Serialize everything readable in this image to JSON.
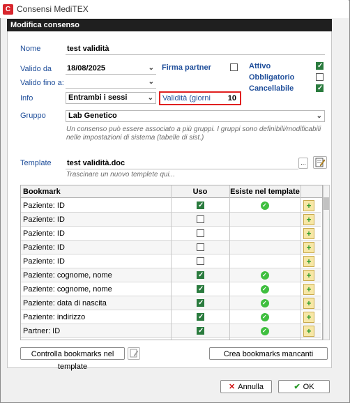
{
  "window": {
    "title": "Consensi MediTEX",
    "icon": "meditex-app-icon"
  },
  "dialog": {
    "title": "Modifica consenso"
  },
  "form": {
    "nome_label": "Nome",
    "nome_value": "test validità",
    "valido_da_label": "Valido da",
    "valido_da_value": "18/08/2025",
    "valido_fino_label": "Valido fino a:",
    "valido_fino_value": "",
    "info_label": "Info",
    "info_value": "Entrambi i sessi",
    "firma_partner_label": "Firma partner",
    "firma_partner_checked": false,
    "validita_label": "Validità (giorni",
    "validita_value": "10",
    "attivo_label": "Attivo",
    "attivo_checked": true,
    "obbligatorio_label": "Obbligatorio",
    "obbligatorio_checked": false,
    "cancellabile_label": "Cancellabile",
    "cancellabile_checked": true,
    "gruppo_label": "Gruppo",
    "gruppo_value": "Lab Genetico",
    "gruppo_hint": "Un consenso può essere associato a più gruppi. I gruppi sono definibili/modificabili nelle impostazioni di sistema (tabelle di sist.)",
    "template_label": "Template",
    "template_value": "test validità.doc",
    "template_hint": "Trascinare un nuovo templete qui...",
    "template_browse": "..."
  },
  "grid": {
    "headers": {
      "bookmark": "Bookmark",
      "uso": "Uso",
      "esiste": "Esiste nel template"
    },
    "rows": [
      {
        "bookmark": "Paziente: ID",
        "uso": true,
        "esiste": true
      },
      {
        "bookmark": "Paziente: ID",
        "uso": false,
        "esiste": false
      },
      {
        "bookmark": "Paziente: ID",
        "uso": false,
        "esiste": false
      },
      {
        "bookmark": "Paziente: ID",
        "uso": false,
        "esiste": false
      },
      {
        "bookmark": "Paziente: ID",
        "uso": false,
        "esiste": false
      },
      {
        "bookmark": "Paziente: cognome, nome",
        "uso": true,
        "esiste": true
      },
      {
        "bookmark": "Paziente: cognome, nome",
        "uso": true,
        "esiste": true
      },
      {
        "bookmark": "Paziente: data di nascita",
        "uso": true,
        "esiste": true
      },
      {
        "bookmark": "Paziente: indirizzo",
        "uso": true,
        "esiste": true
      },
      {
        "bookmark": "Partner: ID",
        "uso": true,
        "esiste": true
      }
    ]
  },
  "buttons": {
    "controlla": "Controlla bookmarks nel template",
    "crea": "Crea bookmarks mancanti",
    "annulla": "Annulla",
    "ok": "OK"
  },
  "colors": {
    "label_blue": "#1f4e9a",
    "check_green": "#2a7b3e",
    "header_dark": "#1f1f1f",
    "highlight_red": "#e02020"
  }
}
